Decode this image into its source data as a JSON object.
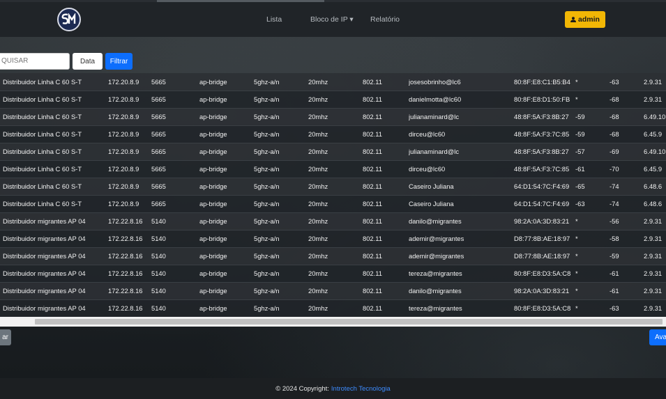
{
  "nav": {
    "items": [
      "Lista",
      "Bloco de IP ▾",
      "Relatório"
    ],
    "admin_label": "admin"
  },
  "filters": {
    "search_placeholder": "PESQUISAR",
    "search_visible": "QUISAR",
    "date_label": "Data",
    "filter_label": "Filtrar"
  },
  "table": {
    "rows": [
      [
        "Distribuidor Linha C 60 S-T",
        "172.20.8.9",
        "5665",
        "ap-bridge",
        "5ghz-a/n",
        "20mhz",
        "802.11",
        "josesobrinho@lc6",
        "80:8F:E8:C1:B5:B4",
        "*",
        "-63",
        "2.9.31"
      ],
      [
        "Distribuidor Linha C 60 S-T",
        "172.20.8.9",
        "5665",
        "ap-bridge",
        "5ghz-a/n",
        "20mhz",
        "802.11",
        "danielmotta@lc60",
        "80:8F:E8:D1:50:FB",
        "*",
        "-68",
        "2.9.31"
      ],
      [
        "Distribuidor Linha C 60 S-T",
        "172.20.8.9",
        "5665",
        "ap-bridge",
        "5ghz-a/n",
        "20mhz",
        "802.11",
        "julianaminard@lc",
        "48:8F:5A:F3:8B:27",
        "-59",
        "-68",
        "6.49.10"
      ],
      [
        "Distribuidor Linha C 60 S-T",
        "172.20.8.9",
        "5665",
        "ap-bridge",
        "5ghz-a/n",
        "20mhz",
        "802.11",
        "dirceu@lc60",
        "48:8F:5A:F3:7C:85",
        "-59",
        "-68",
        "6.45.9"
      ],
      [
        "Distribuidor Linha C 60 S-T",
        "172.20.8.9",
        "5665",
        "ap-bridge",
        "5ghz-a/n",
        "20mhz",
        "802.11",
        "julianaminard@lc",
        "48:8F:5A:F3:8B:27",
        "-57",
        "-69",
        "6.49.10"
      ],
      [
        "Distribuidor Linha C 60 S-T",
        "172.20.8.9",
        "5665",
        "ap-bridge",
        "5ghz-a/n",
        "20mhz",
        "802.11",
        "dirceu@lc60",
        "48:8F:5A:F3:7C:85",
        "-61",
        "-70",
        "6.45.9"
      ],
      [
        "Distribuidor Linha C 60 S-T",
        "172.20.8.9",
        "5665",
        "ap-bridge",
        "5ghz-a/n",
        "20mhz",
        "802.11",
        "Caseiro Juliana",
        "64:D1:54:7C:F4:69",
        "-65",
        "-74",
        "6.48.6"
      ],
      [
        "Distribuidor Linha C 60 S-T",
        "172.20.8.9",
        "5665",
        "ap-bridge",
        "5ghz-a/n",
        "20mhz",
        "802.11",
        "Caseiro Juliana",
        "64:D1:54:7C:F4:69",
        "-63",
        "-74",
        "6.48.6"
      ],
      [
        "Distribuidor migrantes AP 04",
        "172.22.8.16",
        "5140",
        "ap-bridge",
        "5ghz-a/n",
        "20mhz",
        "802.11",
        "danilo@migrantes",
        "98:2A:0A:3D:83:21",
        "*",
        "-56",
        "2.9.31"
      ],
      [
        "Distribuidor migrantes AP 04",
        "172.22.8.16",
        "5140",
        "ap-bridge",
        "5ghz-a/n",
        "20mhz",
        "802.11",
        "ademir@migrantes",
        "D8:77:8B:AE:18:97",
        "*",
        "-58",
        "2.9.31"
      ],
      [
        "Distribuidor migrantes AP 04",
        "172.22.8.16",
        "5140",
        "ap-bridge",
        "5ghz-a/n",
        "20mhz",
        "802.11",
        "ademir@migrantes",
        "D8:77:8B:AE:18:97",
        "*",
        "-59",
        "2.9.31"
      ],
      [
        "Distribuidor migrantes AP 04",
        "172.22.8.16",
        "5140",
        "ap-bridge",
        "5ghz-a/n",
        "20mhz",
        "802.11",
        "tereza@migrantes",
        "80:8F:E8:D3:5A:C8",
        "*",
        "-61",
        "2.9.31"
      ],
      [
        "Distribuidor migrantes AP 04",
        "172.22.8.16",
        "5140",
        "ap-bridge",
        "5ghz-a/n",
        "20mhz",
        "802.11",
        "danilo@migrantes",
        "98:2A:0A:3D:83:21",
        "*",
        "-61",
        "2.9.31"
      ],
      [
        "Distribuidor migrantes AP 04",
        "172.22.8.16",
        "5140",
        "ap-bridge",
        "5ghz-a/n",
        "20mhz",
        "802.11",
        "tereza@migrantes",
        "80:8F:E8:D3:5A:C8",
        "*",
        "-63",
        "2.9.31"
      ]
    ]
  },
  "pagination": {
    "prev_label": "ar",
    "next_label": "Ava"
  },
  "footer": {
    "text": "© 2024 Copyright:",
    "link": "Introtech Tecnologia"
  },
  "colors": {
    "accent": "#0d6efd",
    "admin": "#f2b705"
  }
}
